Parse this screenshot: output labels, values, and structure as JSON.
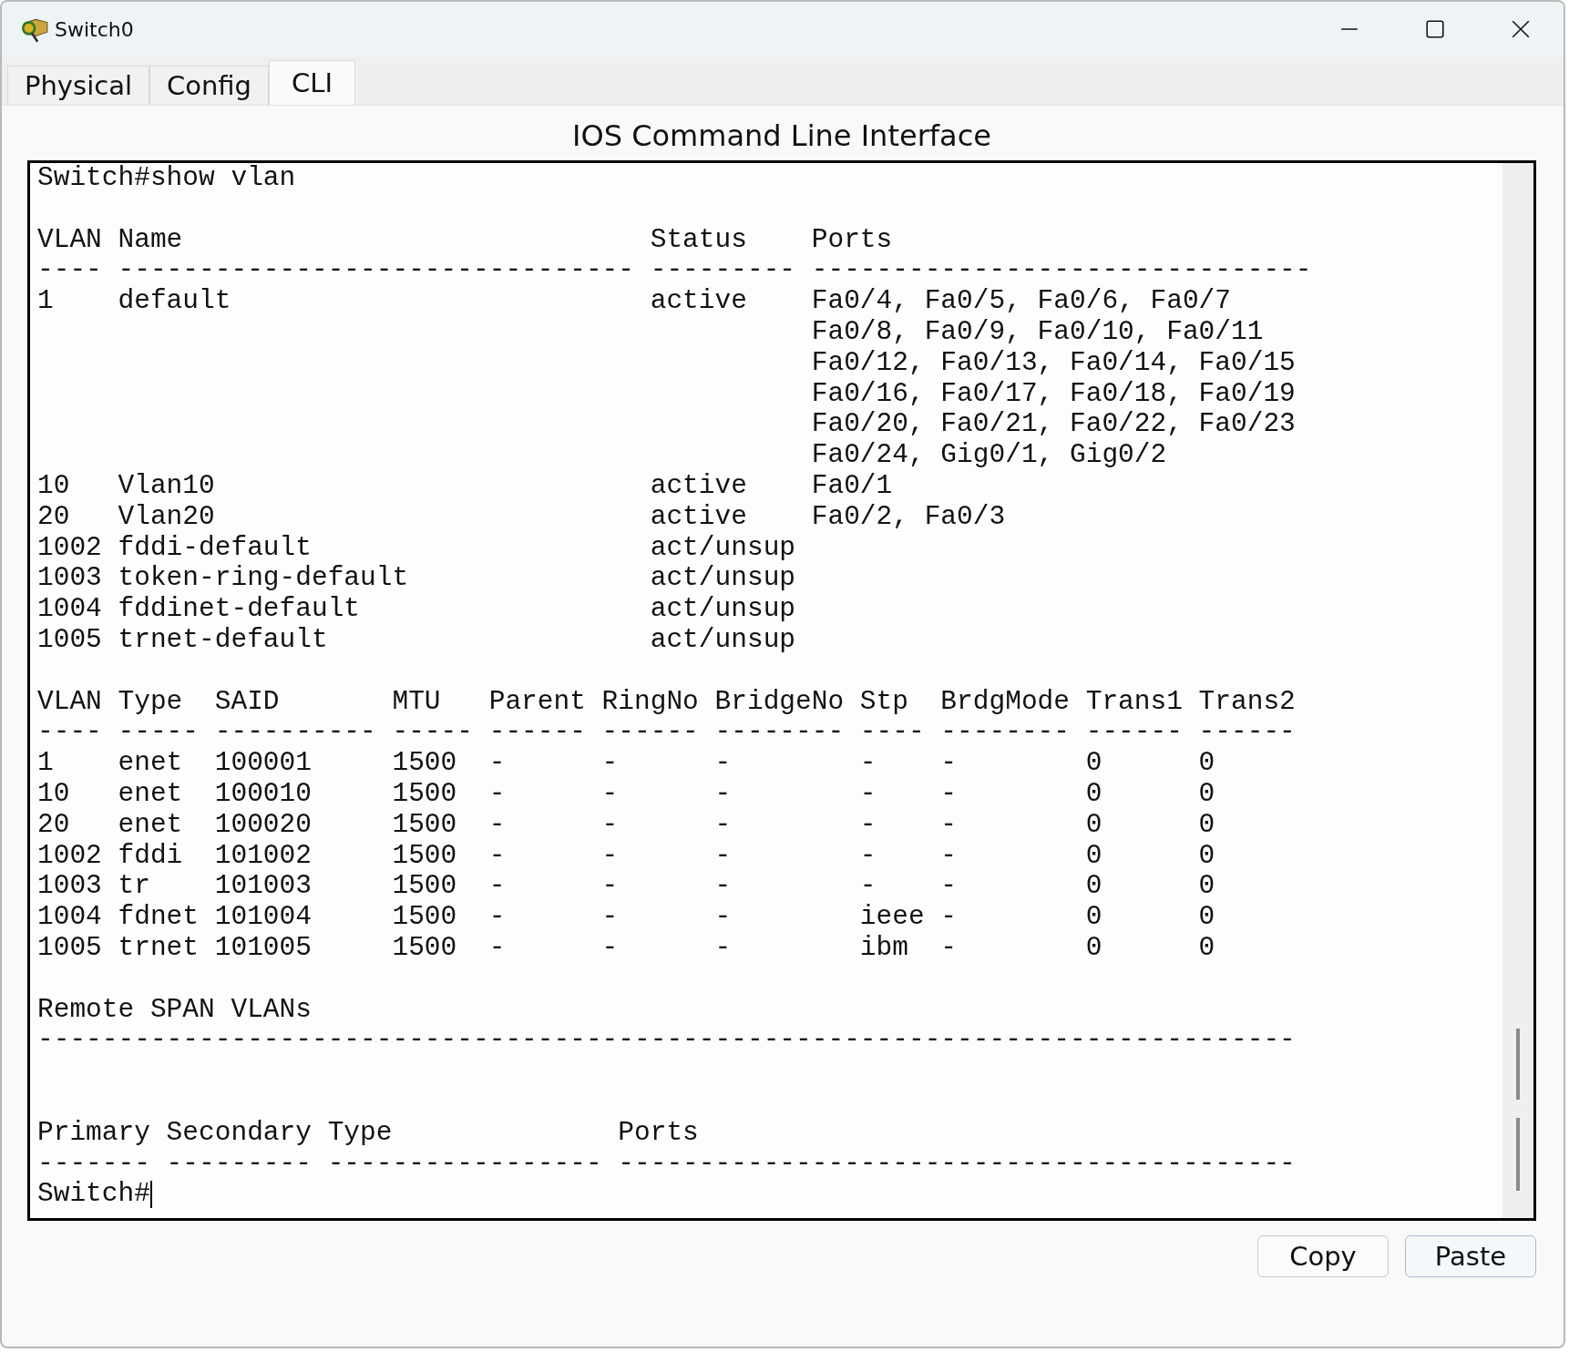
{
  "window": {
    "title": "Switch0"
  },
  "tabs": [
    {
      "label": "Physical",
      "selected": false
    },
    {
      "label": "Config",
      "selected": false
    },
    {
      "label": "CLI",
      "selected": true
    }
  ],
  "heading": "IOS Command Line Interface",
  "terminal": {
    "lines": [
      {
        "kind": "text",
        "text": "Switch#show vlan"
      },
      {
        "kind": "blank"
      },
      {
        "kind": "text",
        "text": "VLAN Name                             Status    Ports"
      },
      {
        "kind": "text",
        "text": "---- -------------------------------- --------- -------------------------------"
      },
      {
        "kind": "text",
        "text": "1    default                          active    Fa0/4, Fa0/5, Fa0/6, Fa0/7"
      },
      {
        "kind": "text",
        "text": "                                                Fa0/8, Fa0/9, Fa0/10, Fa0/11"
      },
      {
        "kind": "text",
        "text": "                                                Fa0/12, Fa0/13, Fa0/14, Fa0/15"
      },
      {
        "kind": "text",
        "text": "                                                Fa0/16, Fa0/17, Fa0/18, Fa0/19"
      },
      {
        "kind": "text",
        "text": "                                                Fa0/20, Fa0/21, Fa0/22, Fa0/23"
      },
      {
        "kind": "text",
        "text": "                                                Fa0/24, Gig0/1, Gig0/2"
      },
      {
        "kind": "text",
        "text": "10   Vlan10                           active    Fa0/1"
      },
      {
        "kind": "text",
        "text": "20   Vlan20                           active    Fa0/2, Fa0/3"
      },
      {
        "kind": "text",
        "text": "1002 fddi-default                     act/unsup"
      },
      {
        "kind": "text",
        "text": "1003 token-ring-default               act/unsup"
      },
      {
        "kind": "text",
        "text": "1004 fddinet-default                  act/unsup"
      },
      {
        "kind": "text",
        "text": "1005 trnet-default                    act/unsup"
      },
      {
        "kind": "blank"
      },
      {
        "kind": "text",
        "text": "VLAN Type  SAID       MTU   Parent RingNo BridgeNo Stp  BrdgMode Trans1 Trans2"
      },
      {
        "kind": "text",
        "text": "---- ----- ---------- ----- ------ ------ -------- ---- -------- ------ ------"
      },
      {
        "kind": "text",
        "text": "1    enet  100001     1500  -      -      -        -    -        0      0"
      },
      {
        "kind": "text",
        "text": "10   enet  100010     1500  -      -      -        -    -        0      0"
      },
      {
        "kind": "text",
        "text": "20   enet  100020     1500  -      -      -        -    -        0      0"
      },
      {
        "kind": "text",
        "text": "1002 fddi  101002     1500  -      -      -        -    -        0      0"
      },
      {
        "kind": "text",
        "text": "1003 tr    101003     1500  -      -      -        -    -        0      0"
      },
      {
        "kind": "text",
        "text": "1004 fdnet 101004     1500  -      -      -        ieee -        0      0"
      },
      {
        "kind": "text",
        "text": "1005 trnet 101005     1500  -      -      -        ibm  -        0      0"
      },
      {
        "kind": "blank"
      },
      {
        "kind": "text",
        "text": "Remote SPAN VLANs"
      },
      {
        "kind": "text",
        "text": "------------------------------------------------------------------------------"
      },
      {
        "kind": "blank"
      },
      {
        "kind": "blank"
      },
      {
        "kind": "text",
        "text": "Primary Secondary Type              Ports"
      },
      {
        "kind": "text",
        "text": "------- --------- ----------------- ------------------------------------------"
      },
      {
        "kind": "prompt",
        "text": "Switch#"
      }
    ]
  },
  "buttons": [
    {
      "label": "Copy"
    },
    {
      "label": "Paste"
    }
  ]
}
